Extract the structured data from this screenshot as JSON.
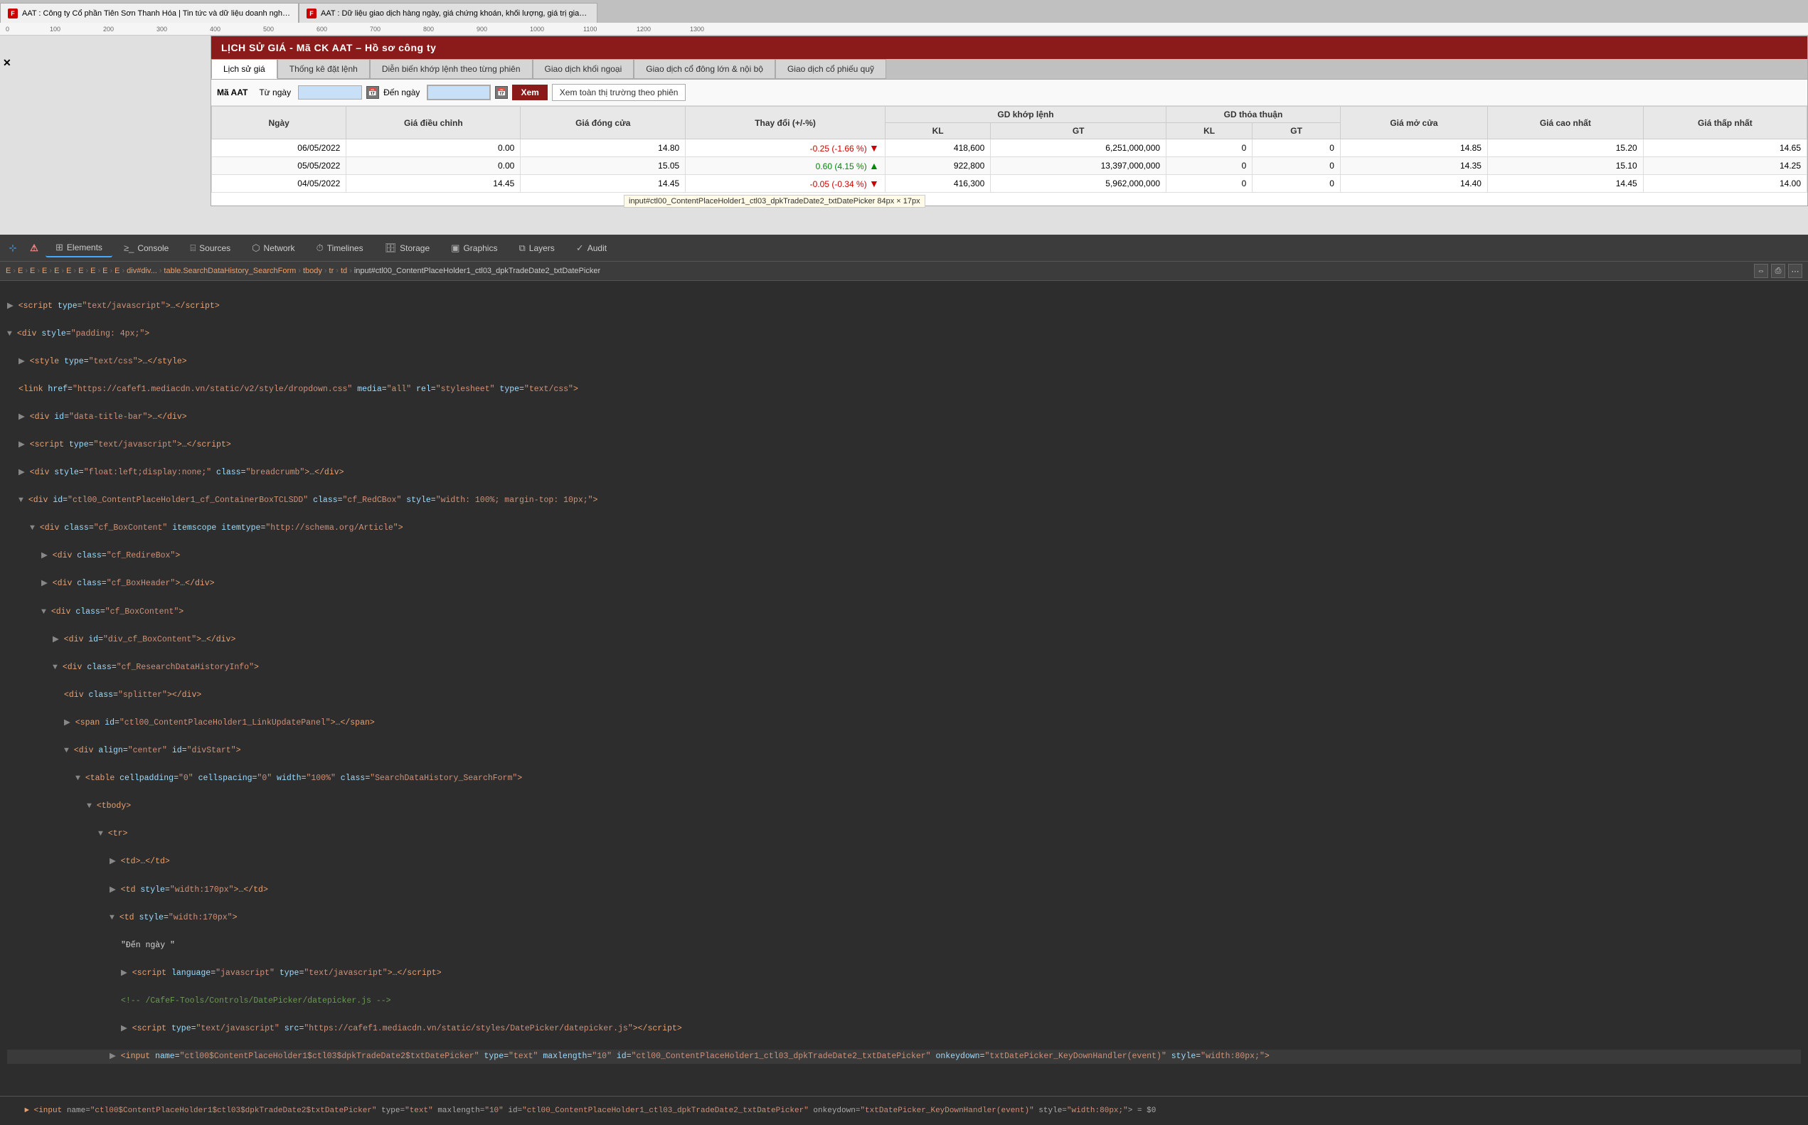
{
  "browser": {
    "tab1": {
      "favicon": "F",
      "label": "AAT : Công ty Cổ phần Tiên Sơn Thanh Hóa | Tin tức và dữ liệu doanh nghiệp | CafeF.vn"
    },
    "tab2": {
      "favicon": "F",
      "label": "AAT : Dữ liệu giao dịch hàng ngày, giá chứng khoán, khối lượng, giá trị giao dịch | CafeF.vn"
    }
  },
  "ruler": {
    "marks": [
      "100",
      "200",
      "300",
      "400",
      "500",
      "600",
      "700",
      "800",
      "900",
      "1000",
      "1100",
      "1200",
      "1300"
    ]
  },
  "page": {
    "title": "LỊCH SỬ GIÁ - Mã CK AAT – Hồ sơ công ty",
    "tabs": [
      {
        "label": "Lịch sử giá",
        "active": true
      },
      {
        "label": "Thống kê đặt lệnh",
        "active": false
      },
      {
        "label": "Diễn biến khớp lệnh theo từng phiên",
        "active": false
      },
      {
        "label": "Giao dịch khối ngoại",
        "active": false
      },
      {
        "label": "Giao dịch cổ đông lớn & nội bộ",
        "active": false
      },
      {
        "label": "Giao dịch cổ phiếu quỹ",
        "active": false
      }
    ],
    "filter": {
      "ma_label": "Mã AAT",
      "tu_ngay_label": "Từ ngày",
      "den_ngay_label": "Đến ngày",
      "tu_ngay_value": "",
      "den_ngay_value": "",
      "btn_xem": "Xem",
      "btn_market": "Xem toàn thị trường theo phiên"
    },
    "tooltip": "input#ctl00_ContentPlaceHolder1_ctl03_dpkTradeDate2_txtDatePicker  84px × 17px",
    "table": {
      "headers": {
        "ngay": "Ngày",
        "gia_dc": "Giá điều chỉnh",
        "gia_dc2": "Giá đóng cửa",
        "thay_doi": "Thay đổi (+/-%%)",
        "gd_khop_kl": "KL",
        "gd_khop_gt": "GT",
        "gd_thoa_kl": "KL",
        "gd_thoa_gt": "GT",
        "gia_mo": "Giá mở cửa",
        "gia_cao": "Giá cao nhất",
        "gia_thap": "Giá thấp nhất",
        "gd_khop_label": "GD khớp lệnh",
        "gd_thoa_label": "GD thỏa thuận"
      },
      "rows": [
        {
          "ngay": "06/05/2022",
          "gia_dc": "0.00",
          "gia_dong_cua": "14.80",
          "thay_doi": "-0.25 (-1.66 %)",
          "thay_doi_type": "neg",
          "arrow": "▼",
          "kl": "418,600",
          "gt": "6,251,000,000",
          "thoa_kl": "0",
          "thoa_gt": "0",
          "gia_mo": "14.85",
          "gia_cao": "15.20",
          "gia_thap": "14.65"
        },
        {
          "ngay": "05/05/2022",
          "gia_dc": "0.00",
          "gia_dong_cua": "15.05",
          "thay_doi": "0.60 (4.15 %)",
          "thay_doi_type": "pos",
          "arrow": "▲",
          "kl": "922,800",
          "gt": "13,397,000,000",
          "thoa_kl": "0",
          "thoa_gt": "0",
          "gia_mo": "14.35",
          "gia_cao": "15.10",
          "gia_thap": "14.25"
        },
        {
          "ngay": "04/05/2022",
          "gia_dc": "14.45",
          "gia_dong_cua": "14.45",
          "thay_doi": "-0.05 (-0.34 %)",
          "thay_doi_type": "neg",
          "arrow": "▼",
          "kl": "416,300",
          "gt": "5,962,000,000",
          "thoa_kl": "0",
          "thoa_gt": "0",
          "gia_mo": "14.40",
          "gia_cao": "14.45",
          "gia_thap": "14.00"
        }
      ]
    }
  },
  "devtools": {
    "tabs": [
      {
        "label": "Elements",
        "icon": "⊞",
        "active": true
      },
      {
        "label": "Console",
        "icon": "≥_",
        "active": false
      },
      {
        "label": "Sources",
        "icon": "⌸",
        "active": false
      },
      {
        "label": "Network",
        "icon": "⬡",
        "active": false
      },
      {
        "label": "Timelines",
        "icon": "⏱",
        "active": false
      },
      {
        "label": "Storage",
        "icon": "🗄",
        "active": false
      },
      {
        "label": "Graphics",
        "icon": "▣",
        "active": false
      },
      {
        "label": "Layers",
        "icon": "⧉",
        "active": false
      },
      {
        "label": "Audit",
        "icon": "✓",
        "active": false
      }
    ],
    "breadcrumb": [
      {
        "label": "E",
        "type": "item"
      },
      {
        "label": "E",
        "type": "item"
      },
      {
        "label": "E",
        "type": "item"
      },
      {
        "label": "E",
        "type": "item"
      },
      {
        "label": "E",
        "type": "item"
      },
      {
        "label": "E",
        "type": "item"
      },
      {
        "label": "E",
        "type": "item"
      },
      {
        "label": "E",
        "type": "item"
      },
      {
        "label": "E",
        "type": "item"
      },
      {
        "label": "E",
        "type": "item"
      },
      {
        "label": "div#div...",
        "type": "item"
      },
      {
        "label": "table.SearchDataHistory_SearchForm",
        "type": "item"
      },
      {
        "label": "tbody",
        "type": "item"
      },
      {
        "label": "tr",
        "type": "item"
      },
      {
        "label": "td",
        "type": "item"
      },
      {
        "label": "input#ctl00_ContentPlaceHolder1_ctl03_dpkTradeDate2_txtDatePicker",
        "type": "current"
      }
    ],
    "code_lines": [
      {
        "indent": 0,
        "html": "<a class=\"c-tag\">script</a> <span class=\"c-attr\">type</span>=<span class=\"c-val\">\"text/javascript\"</span>&gt;…&lt;/<span class=\"c-tag\">script</span>&gt;"
      },
      {
        "indent": 0,
        "html": "▼ <span class=\"c-tag\">&lt;div</span> <span class=\"c-attr\">style</span>=<span class=\"c-val\">\"padding: 4px;\"</span><span class=\"c-tag\">&gt;</span>"
      },
      {
        "indent": 1,
        "html": "▶ <span class=\"c-tag\">&lt;style</span> <span class=\"c-attr\">type</span>=<span class=\"c-val\">\"text/css\"</span>&gt;…&lt;/<span class=\"c-tag\">style</span>&gt;"
      },
      {
        "indent": 1,
        "html": "<span class=\"c-tag\">&lt;link</span> <span class=\"c-attr\">href</span>=<span class=\"c-val\">\"https://cafef1.mediacdn.vn/static/v2/style/dropdown.css\"</span> <span class=\"c-attr\">media</span>=<span class=\"c-val\">\"all\"</span> <span class=\"c-attr\">rel</span>=<span class=\"c-val\">\"stylesheet\"</span> <span class=\"c-attr\">type</span>=<span class=\"c-val\">\"text/css\"</span>&gt;"
      },
      {
        "indent": 1,
        "html": "▶ <span class=\"c-tag\">&lt;div</span> <span class=\"c-attr\">id</span>=<span class=\"c-val\">\"data-title-bar\"</span>&gt;…&lt;/<span class=\"c-tag\">div</span>&gt;"
      },
      {
        "indent": 1,
        "html": "▶ <span class=\"c-tag\">&lt;script</span> <span class=\"c-attr\">type</span>=<span class=\"c-val\">\"text/javascript\"</span>&gt;…&lt;/<span class=\"c-tag\">script</span>&gt;"
      },
      {
        "indent": 1,
        "html": "▶ <span class=\"c-tag\">&lt;div</span> <span class=\"c-attr\">style</span>=<span class=\"c-val\">\"float:left;display:none;\"</span> <span class=\"c-attr\">class</span>=<span class=\"c-val\">\"breadcrumb\"</span>&gt;…&lt;/<span class=\"c-tag\">div</span>&gt;"
      },
      {
        "indent": 1,
        "html": "▼ <span class=\"c-tag\">&lt;div</span> <span class=\"c-attr\">id</span>=<span class=\"c-val\">\"ctl00_ContentPlaceHolder1_cf_ContainerBoxTCLSDD\"</span> <span class=\"c-attr\">class</span>=<span class=\"c-val\">\"cf_RedCBox\"</span> <span class=\"c-attr\">style</span>=<span class=\"c-val\">\"width: 100%; margin-top: 10px;\"</span>&gt;"
      },
      {
        "indent": 2,
        "html": "▼ <span class=\"c-tag\">&lt;div</span> <span class=\"c-attr\">class</span>=<span class=\"c-val\">\"cf_BoxContent\"</span> <span class=\"c-attr\">itemscope</span> <span class=\"c-attr\">itemtype</span>=<span class=\"c-val\">\"http://schema.org/Article\"</span>&gt;"
      },
      {
        "indent": 3,
        "html": "▶ <span class=\"c-tag\">&lt;div</span> <span class=\"c-attr\">class</span>=<span class=\"c-val\">\"cf_RedireBox\"</span>&gt;"
      },
      {
        "indent": 4,
        "html": "▶ <span class=\"c-tag\">&lt;div</span> <span class=\"c-attr\">class</span>=<span class=\"c-val\">\"cf_BoxHeader\"</span>&gt;…&lt;/<span class=\"c-tag\">div</span>&gt;"
      },
      {
        "indent": 4,
        "html": "▼ <span class=\"c-tag\">&lt;div</span> <span class=\"c-attr\">class</span>=<span class=\"c-val\">\"cf_BoxContent\"</span>&gt;"
      },
      {
        "indent": 5,
        "html": "▶ <span class=\"c-tag\">&lt;div</span> <span class=\"c-attr\">id</span>=<span class=\"c-val\">\"div_cf_BoxContent\"</span>&gt;…&lt;/<span class=\"c-tag\">div</span>&gt;"
      },
      {
        "indent": 5,
        "html": "▼ <span class=\"c-tag\">&lt;div</span> <span class=\"c-attr\">class</span>=<span class=\"c-val\">\"cf_ResearchDataHistoryInfo\"</span>&gt;"
      },
      {
        "indent": 6,
        "html": "<span class=\"c-tag\">&lt;div</span> <span class=\"c-attr\">class</span>=<span class=\"c-val\">\"splitter\"</span>&gt;&lt;/<span class=\"c-tag\">div</span>&gt;"
      },
      {
        "indent": 6,
        "html": "▶ <span class=\"c-tag\">&lt;span</span> <span class=\"c-attr\">id</span>=<span class=\"c-val\">\"ctl00_ContentPlaceHolder1_LinkUpdatePanel\"</span>&gt;…&lt;/<span class=\"c-tag\">span</span>&gt;"
      },
      {
        "indent": 6,
        "html": "▼ <span class=\"c-tag\">&lt;div</span> <span class=\"c-attr\">align</span>=<span class=\"c-val\">\"center\"</span> <span class=\"c-attr\">id</span>=<span class=\"c-val\">\"divStart\"</span>&gt;"
      },
      {
        "indent": 7,
        "html": "▼ <span class=\"c-tag\">&lt;table</span> <span class=\"c-attr\">cellpadding</span>=<span class=\"c-val\">\"0\"</span> <span class=\"c-attr\">cellspacing</span>=<span class=\"c-val\">\"0\"</span> <span class=\"c-attr\">width</span>=<span class=\"c-val\">\"100%\"</span> <span class=\"c-attr\">class</span>=<span class=\"c-val\">\"SearchDataHistory_SearchForm\"</span>&gt;"
      },
      {
        "indent": 8,
        "html": "▼ <span class=\"c-tag\">&lt;tbody</span>&gt;"
      },
      {
        "indent": 9,
        "html": "▼ <span class=\"c-tag\">&lt;tr</span>&gt;"
      },
      {
        "indent": 10,
        "html": "▶ <span class=\"c-tag\">&lt;td</span>&gt;…&lt;/<span class=\"c-tag\">td</span>&gt;"
      },
      {
        "indent": 10,
        "html": "▶ <span class=\"c-tag\">&lt;td</span> <span class=\"c-attr\">style</span>=<span class=\"c-val\">\"width:170px\"</span>&gt;…&lt;/<span class=\"c-tag\">td</span>&gt;"
      },
      {
        "indent": 10,
        "html": "▼ <span class=\"c-tag\">&lt;td</span> <span class=\"c-attr\">style</span>=<span class=\"c-val\">\"width:170px\"</span>&gt;"
      },
      {
        "indent": 11,
        "html": "<span class=\"c-text\">\"Đến ngày \"</span>"
      },
      {
        "indent": 11,
        "html": "▶ <span class=\"c-tag\">&lt;script</span> <span class=\"c-attr\">language</span>=<span class=\"c-val\">\"javascript\"</span> <span class=\"c-attr\">type</span>=<span class=\"c-val\">\"text/javascript\"</span>&gt;…&lt;/<span class=\"c-tag\">script</span>&gt;"
      },
      {
        "indent": 11,
        "html": "<span class=\"c-comment\">&lt;!-- /CafeF-Tools/Controls/DatePicker/datepicker.js --&gt;</span>"
      },
      {
        "indent": 11,
        "html": "▶ <span class=\"c-tag\">&lt;script</span> <span class=\"c-attr\">type</span>=<span class=\"c-val\">\"text/javascript\"</span> <span class=\"c-attr\">src</span>=<span class=\"c-val\">\"https://cafef1.mediacdn.vn/static/styles/DatePicker/datepicker.js\"</span>&gt;&lt;/<span class=\"c-tag\">script</span>&gt;"
      }
    ],
    "status_bar": "► <input name=\"ctl00$ContentPlaceHolder1$ctl03$dpkTradeDate2$txtDatePicker\" type=\"text\" maxlength=\"10\" id=\"ctl00_ContentPlaceHolder1_ctl03_dpkTradeDate2_txtDatePicker\" onkeydown=\"txtDatePicker_KeyDownHandler(event)\" style=\"width:80px;\"> = $0"
  }
}
